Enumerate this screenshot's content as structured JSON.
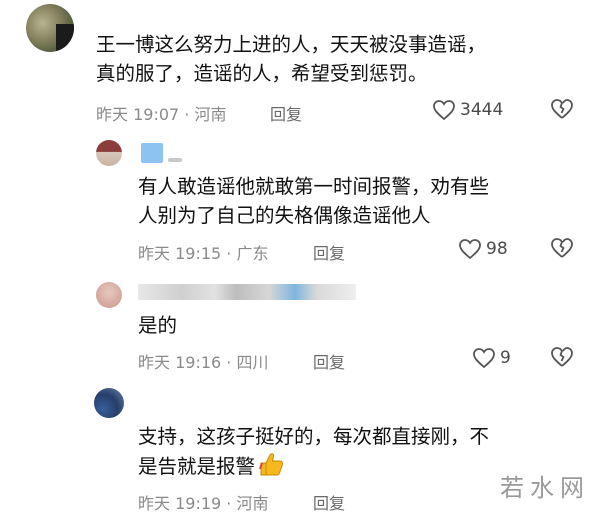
{
  "comments": [
    {
      "text_lines": [
        "王一博这么努力上进的人，天天被没事造谣，",
        "真的服了，造谣的人，希望受到惩罚。"
      ],
      "time": "昨天 19:07 · 河南",
      "reply": "回复",
      "likes": "3444"
    }
  ],
  "replies": [
    {
      "text_lines": [
        "有人敢造谣他就敢第一时间报警，劝有些",
        "人别为了自己的失格偶像造谣他人"
      ],
      "time": "昨天 19:15 · 广东",
      "reply": "回复",
      "likes": "98"
    },
    {
      "text_lines": [
        "是的"
      ],
      "time": "昨天 19:16 · 四川",
      "reply": "回复",
      "likes": "9"
    },
    {
      "text_lines": [
        "支持，这孩子挺好的，每次都直接刚，不",
        "是告就是报警"
      ],
      "time": "昨天 19:19 · 河南",
      "reply": "回复",
      "likes": ""
    }
  ],
  "watermark": "若水网",
  "icons": {
    "like": "heart-outline-icon",
    "dislike": "broken-heart-icon",
    "thumb": "thumbs-up-emoji"
  },
  "colors": {
    "text": "#111111",
    "meta": "#8a8a8a",
    "emoji": "#f5b820"
  }
}
